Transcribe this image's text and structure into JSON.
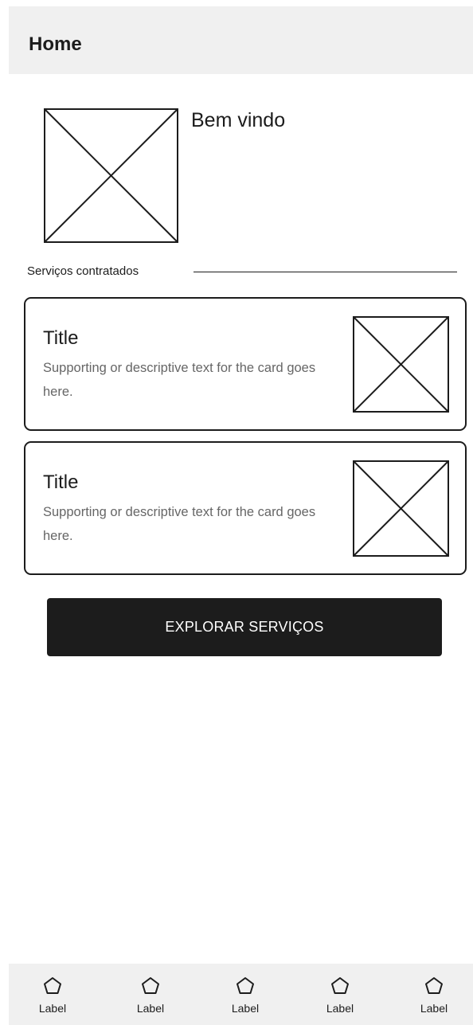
{
  "header": {
    "title": "Home"
  },
  "welcome": {
    "text": "Bem vindo",
    "image_icon": "image-placeholder-icon"
  },
  "section": {
    "label": "Serviços contratados"
  },
  "cards": [
    {
      "title": "Title",
      "text": "Supporting or descriptive text for the card goes here.",
      "image_icon": "image-placeholder-icon"
    },
    {
      "title": "Title",
      "text": "Supporting or descriptive text for the card goes here.",
      "image_icon": "image-placeholder-icon"
    }
  ],
  "button": {
    "label": "EXPLORAR SERVIÇOS"
  },
  "bottom_nav": {
    "items": [
      {
        "label": "Label",
        "icon": "pentagon-icon"
      },
      {
        "label": "Label",
        "icon": "pentagon-icon"
      },
      {
        "label": "Label",
        "icon": "pentagon-icon"
      },
      {
        "label": "Label",
        "icon": "pentagon-icon"
      },
      {
        "label": "Label",
        "icon": "pentagon-icon"
      }
    ]
  },
  "colors": {
    "primary": "#1c1c1c",
    "surface": "#f0f0f0",
    "muted_text": "#666666",
    "background": "#ffffff"
  }
}
